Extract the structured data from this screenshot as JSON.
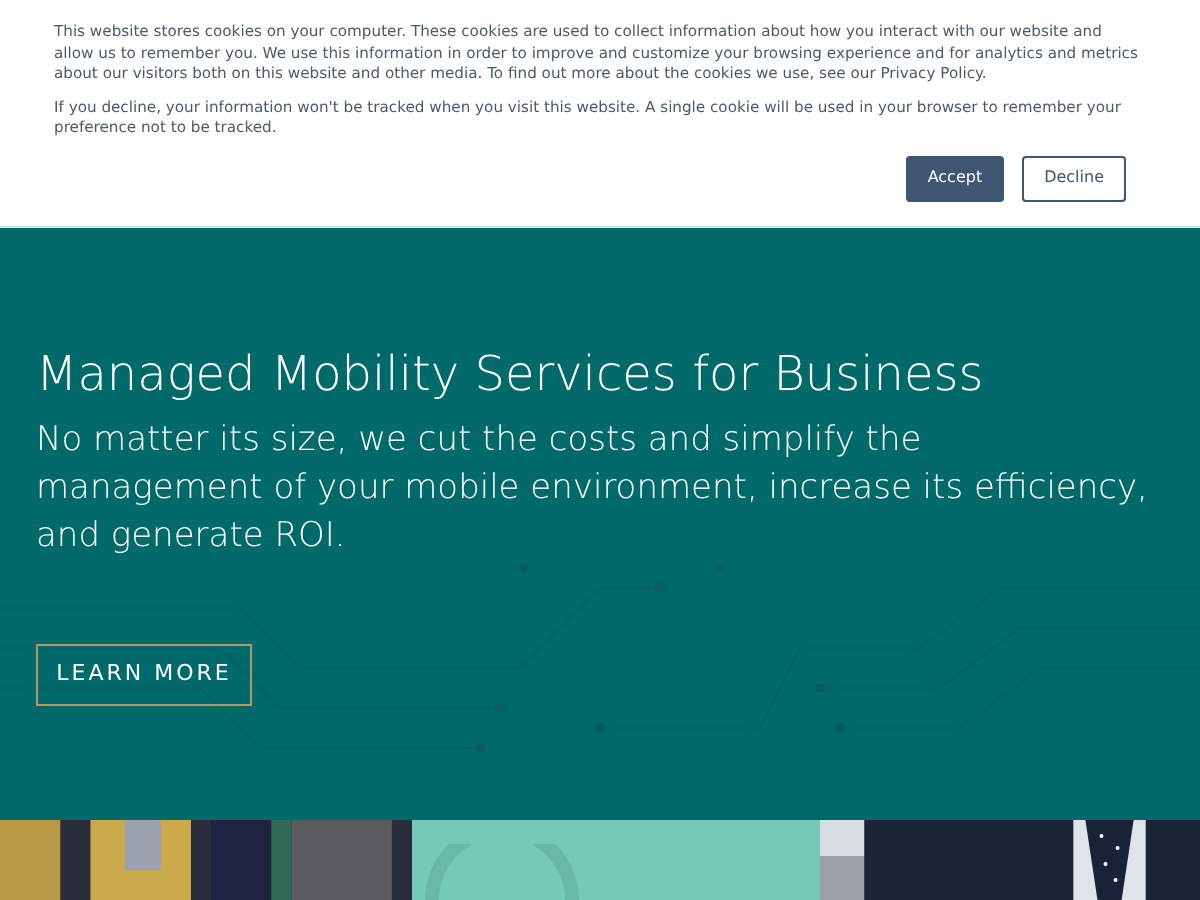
{
  "cookie_banner": {
    "paragraphs": [
      "This website stores cookies on your computer. These cookies are used to collect information about how you interact with our website and allow us to remember you. We use this information in order to improve and customize your browsing experience and for analytics and metrics about our visitors both on this website and other media. To find out more about the cookies we use, see our Privacy Policy.",
      "If you decline, your information won't be tracked when you visit this website. A single cookie will be used in your browser to remember your preference not to be tracked."
    ],
    "buttons": [
      {
        "label": "Accept",
        "kind": "primary"
      },
      {
        "label": "Decline",
        "kind": "secondary"
      }
    ]
  },
  "hero": {
    "title": "Managed Mobility Services for Business",
    "subtitle": "No matter its size, we cut the costs and simplify the management of your mobile environment, increase its efficiency, and generate ROI.",
    "button": "LEARN MORE"
  },
  "tiles": [
    {
      "kind": "picture"
    },
    {
      "kind": "graphic"
    },
    {
      "kind": "picture"
    }
  ]
}
